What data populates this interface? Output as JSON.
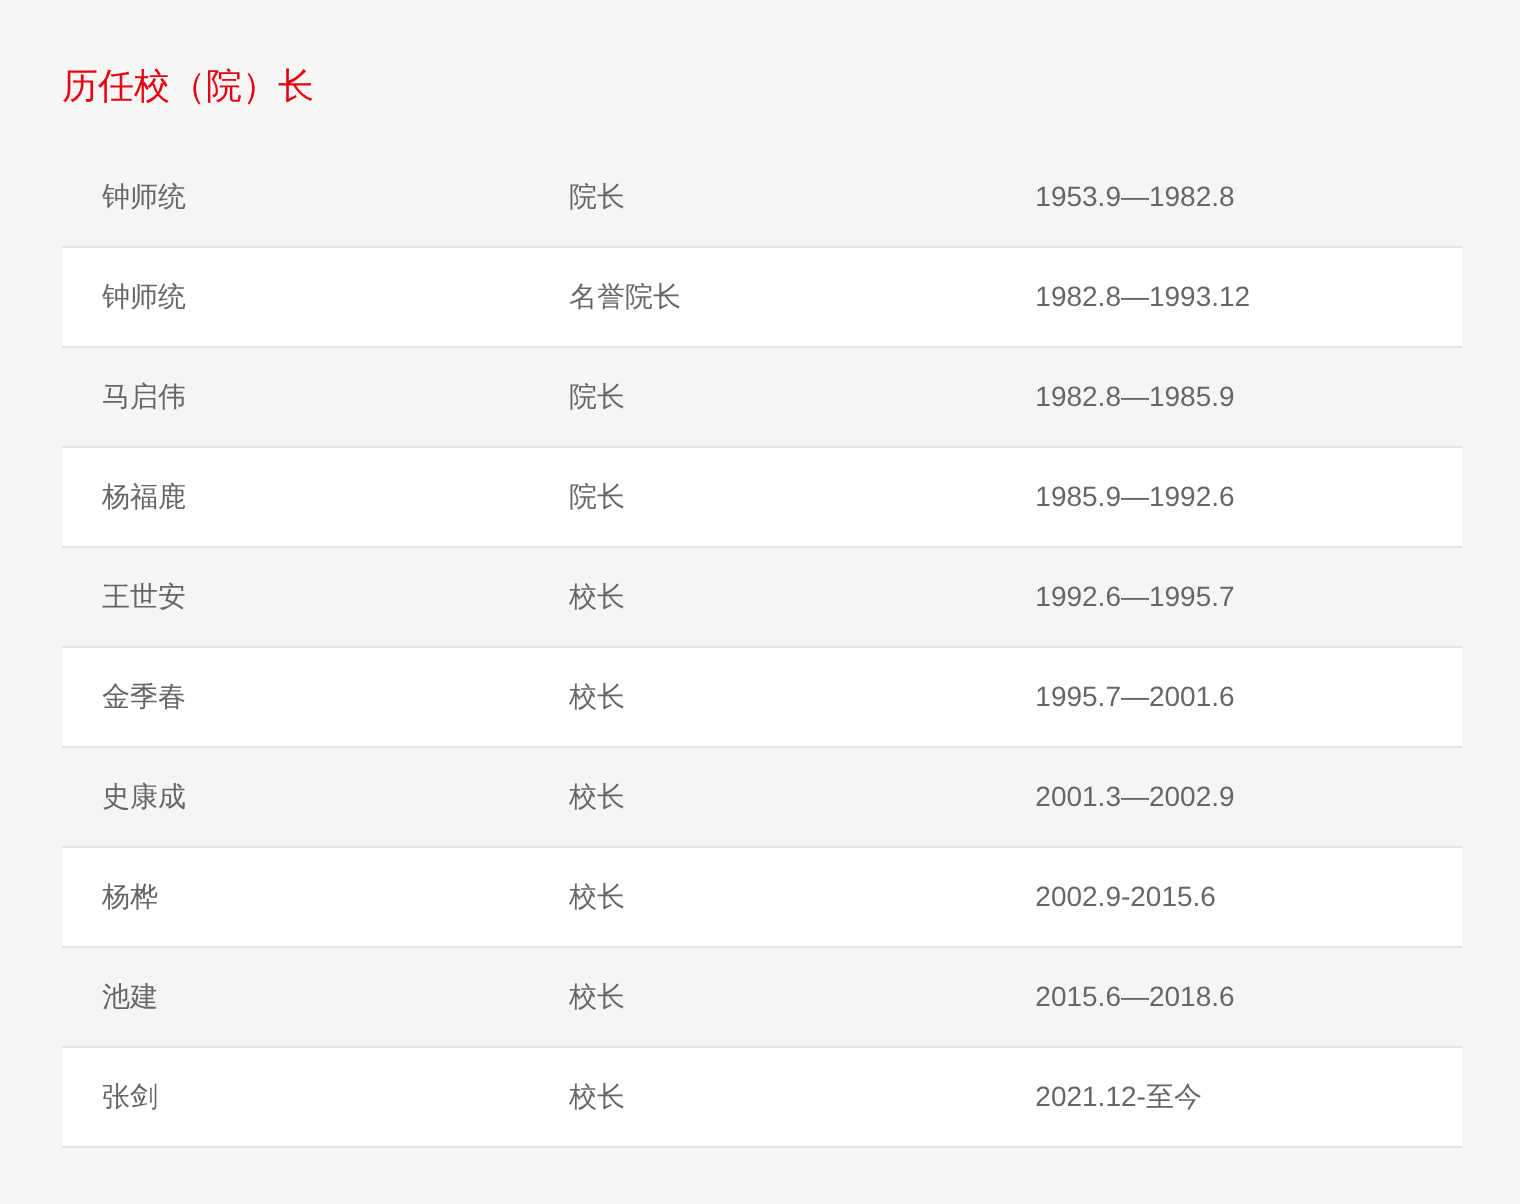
{
  "title": "历任校（院）长",
  "rows": [
    {
      "name": "钟师统",
      "position": "院长",
      "term": "1953.9—1982.8"
    },
    {
      "name": "钟师统",
      "position": "名誉院长",
      "term": "1982.8—1993.12"
    },
    {
      "name": "马启伟",
      "position": "院长",
      "term": "1982.8—1985.9"
    },
    {
      "name": "杨福鹿",
      "position": "院长",
      "term": "1985.9—1992.6"
    },
    {
      "name": "王世安",
      "position": "校长",
      "term": "1992.6—1995.7"
    },
    {
      "name": "金季春",
      "position": "校长",
      "term": "1995.7—2001.6"
    },
    {
      "name": "史康成",
      "position": "校长",
      "term": "2001.3—2002.9"
    },
    {
      "name": "杨桦",
      "position": "校长",
      "term": "2002.9-2015.6"
    },
    {
      "name": "池建",
      "position": "校长",
      "term": "2015.6—2018.6"
    },
    {
      "name": "张剑",
      "position": "校长",
      "term": "2021.12-至今"
    }
  ]
}
